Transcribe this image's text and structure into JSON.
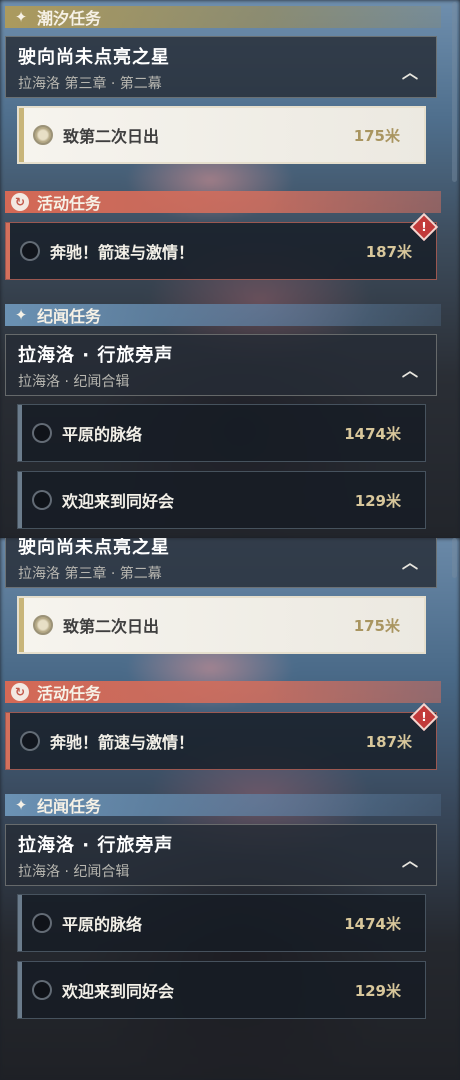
{
  "sections": {
    "tide": {
      "label": "潮汐任务"
    },
    "event": {
      "label": "活动任务"
    },
    "chronicle": {
      "label": "纪闻任务"
    }
  },
  "groups": {
    "tide": {
      "title": "驶向尚未点亮之星",
      "subtitle": "拉海洛 第三章 · 第二幕"
    },
    "chronicle": {
      "title": "拉海洛 · 行旅旁声",
      "subtitle": "拉海洛 · 纪闻合辑"
    }
  },
  "tasks": {
    "sunrise": {
      "name": "致第二次日出",
      "distance": "175米"
    },
    "event": {
      "name": "奔驰！箭速与激情！",
      "distance": "187米"
    },
    "plains": {
      "name": "平原的脉络",
      "distance": "1474米"
    },
    "welcome": {
      "name": "欢迎来到同好会",
      "distance": "129米"
    }
  },
  "icons": {
    "tide_header": "sparkle-icon",
    "event_header": "event-swirl-icon",
    "chronicle_header": "sparkle-icon",
    "collapse": "chevron-up-icon",
    "alert": "alert-diamond-icon"
  },
  "colors": {
    "tide": "#af9b5a",
    "event": "#d7694f",
    "chronicle": "#6e96b9",
    "distance": "#d8c79b"
  }
}
